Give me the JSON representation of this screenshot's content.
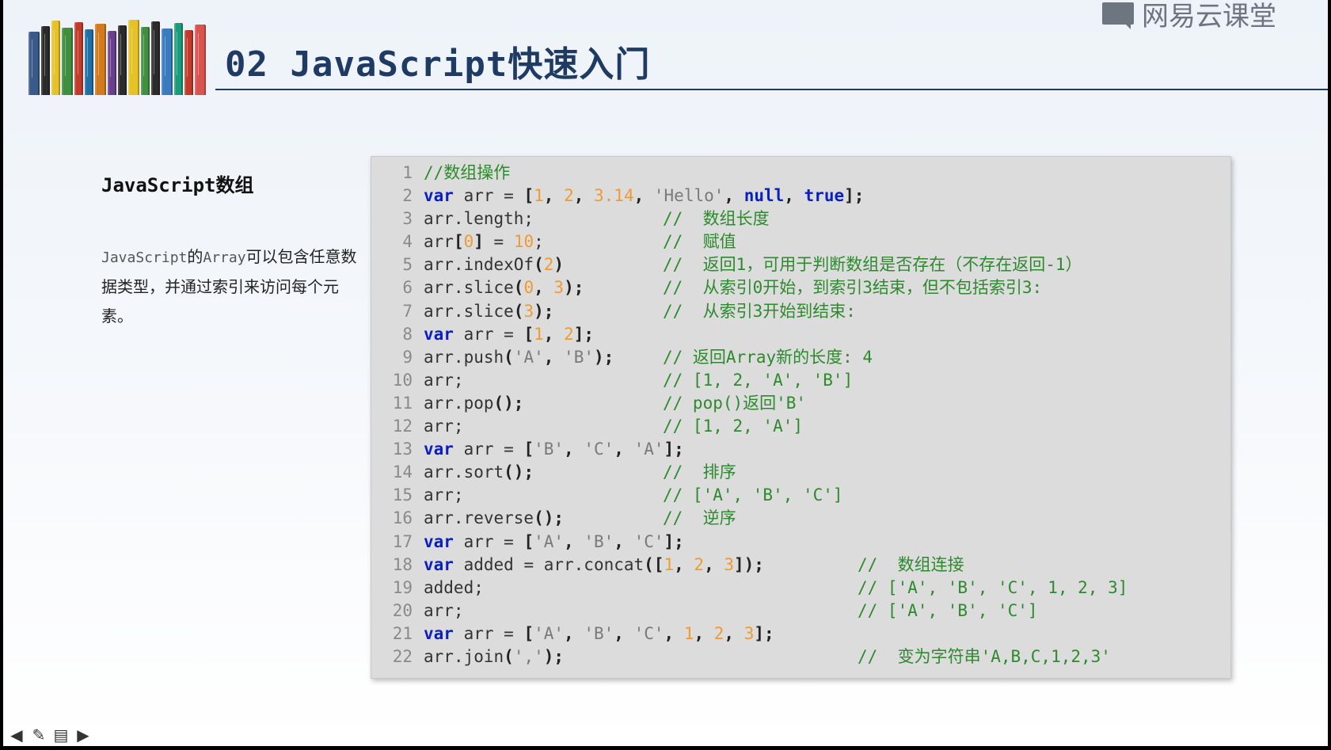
{
  "slide": {
    "title": "02 JavaScript快速入门",
    "brand_text": "网易云课堂",
    "brand_icon": "book-logo-icon",
    "section_title": "JavaScript数组",
    "description": {
      "part1": "JavaScript",
      "part2": "的",
      "part3": "Array",
      "part4": "可以包含任意数据类型，并通过索引来访问每个元素。"
    }
  },
  "books": [
    "#3a5a8a",
    "#2b2b2b",
    "#e6c229",
    "#3f8f3f",
    "#c23b2a",
    "#1f6fa8",
    "#d17a1e",
    "#6b3f8f",
    "#2b2b2b",
    "#e6c229",
    "#3f8f3f",
    "#2b2b2b",
    "#3a7bbf",
    "#1a9c7a",
    "#c23b2a",
    "#d9534f"
  ],
  "code": {
    "lines": [
      {
        "n": "1",
        "tokens": [
          {
            "t": "cm",
            "v": "//数组操作"
          }
        ]
      },
      {
        "n": "2",
        "tokens": [
          {
            "t": "kw",
            "v": "var"
          },
          {
            "t": "tx",
            "v": " arr = "
          },
          {
            "t": "pn",
            "v": "["
          },
          {
            "t": "num",
            "v": "1"
          },
          {
            "t": "pn",
            "v": ", "
          },
          {
            "t": "num",
            "v": "2"
          },
          {
            "t": "pn",
            "v": ", "
          },
          {
            "t": "num",
            "v": "3.14"
          },
          {
            "t": "pn",
            "v": ", "
          },
          {
            "t": "str",
            "v": "'Hello'"
          },
          {
            "t": "pn",
            "v": ", "
          },
          {
            "t": "kw",
            "v": "null"
          },
          {
            "t": "pn",
            "v": ", "
          },
          {
            "t": "kw",
            "v": "true"
          },
          {
            "t": "pn",
            "v": "];"
          }
        ]
      },
      {
        "n": "3",
        "tokens": [
          {
            "t": "tx",
            "v": "arr.length;"
          }
        ],
        "comment": "//  数组长度",
        "ccol": "c1"
      },
      {
        "n": "4",
        "tokens": [
          {
            "t": "tx",
            "v": "arr"
          },
          {
            "t": "pn",
            "v": "["
          },
          {
            "t": "num",
            "v": "0"
          },
          {
            "t": "pn",
            "v": "]"
          },
          {
            "t": "tx",
            "v": " = "
          },
          {
            "t": "num",
            "v": "10"
          },
          {
            "t": "tx",
            "v": ";"
          }
        ],
        "comment": "//  赋值",
        "ccol": "c1"
      },
      {
        "n": "5",
        "tokens": [
          {
            "t": "tx",
            "v": "arr.indexOf"
          },
          {
            "t": "pn",
            "v": "("
          },
          {
            "t": "num",
            "v": "2"
          },
          {
            "t": "pn",
            "v": ")"
          }
        ],
        "comment": "//  返回1，可用于判断数组是否存在（不存在返回-1）",
        "ccol": "c1"
      },
      {
        "n": "6",
        "tokens": [
          {
            "t": "tx",
            "v": "arr.slice"
          },
          {
            "t": "pn",
            "v": "("
          },
          {
            "t": "num",
            "v": "0"
          },
          {
            "t": "pn",
            "v": ", "
          },
          {
            "t": "num",
            "v": "3"
          },
          {
            "t": "pn",
            "v": ");"
          }
        ],
        "comment": "//  从索引0开始，到索引3结束，但不包括索引3:",
        "ccol": "c1"
      },
      {
        "n": "7",
        "tokens": [
          {
            "t": "tx",
            "v": "arr.slice"
          },
          {
            "t": "pn",
            "v": "("
          },
          {
            "t": "num",
            "v": "3"
          },
          {
            "t": "pn",
            "v": ");"
          }
        ],
        "comment": "//  从索引3开始到结束:",
        "ccol": "c1"
      },
      {
        "n": "8",
        "tokens": [
          {
            "t": "kw",
            "v": "var"
          },
          {
            "t": "tx",
            "v": " arr = "
          },
          {
            "t": "pn",
            "v": "["
          },
          {
            "t": "num",
            "v": "1"
          },
          {
            "t": "pn",
            "v": ", "
          },
          {
            "t": "num",
            "v": "2"
          },
          {
            "t": "pn",
            "v": "];"
          }
        ]
      },
      {
        "n": "9",
        "tokens": [
          {
            "t": "tx",
            "v": "arr.push"
          },
          {
            "t": "pn",
            "v": "("
          },
          {
            "t": "str",
            "v": "'A'"
          },
          {
            "t": "pn",
            "v": ", "
          },
          {
            "t": "str",
            "v": "'B'"
          },
          {
            "t": "pn",
            "v": ");"
          }
        ],
        "comment": "// 返回Array新的长度: 4",
        "ccol": "c1"
      },
      {
        "n": "10",
        "tokens": [
          {
            "t": "tx",
            "v": "arr;"
          }
        ],
        "comment": "// [1, 2, 'A', 'B']",
        "ccol": "c1"
      },
      {
        "n": "11",
        "tokens": [
          {
            "t": "tx",
            "v": "arr.pop"
          },
          {
            "t": "pn",
            "v": "();"
          }
        ],
        "comment": "// pop()返回'B'",
        "ccol": "c1"
      },
      {
        "n": "12",
        "tokens": [
          {
            "t": "tx",
            "v": "arr;"
          }
        ],
        "comment": "// [1, 2, 'A']",
        "ccol": "c1"
      },
      {
        "n": "13",
        "tokens": [
          {
            "t": "kw",
            "v": "var"
          },
          {
            "t": "tx",
            "v": " arr = "
          },
          {
            "t": "pn",
            "v": "["
          },
          {
            "t": "str",
            "v": "'B'"
          },
          {
            "t": "pn",
            "v": ", "
          },
          {
            "t": "str",
            "v": "'C'"
          },
          {
            "t": "pn",
            "v": ", "
          },
          {
            "t": "str",
            "v": "'A'"
          },
          {
            "t": "pn",
            "v": "];"
          }
        ]
      },
      {
        "n": "14",
        "tokens": [
          {
            "t": "tx",
            "v": "arr.sort"
          },
          {
            "t": "pn",
            "v": "();"
          }
        ],
        "comment": "//  排序",
        "ccol": "c1"
      },
      {
        "n": "15",
        "tokens": [
          {
            "t": "tx",
            "v": "arr;"
          }
        ],
        "comment": "// ['A', 'B', 'C']",
        "ccol": "c1"
      },
      {
        "n": "16",
        "tokens": [
          {
            "t": "tx",
            "v": "arr.reverse"
          },
          {
            "t": "pn",
            "v": "();"
          }
        ],
        "comment": "//  逆序",
        "ccol": "c1"
      },
      {
        "n": "17",
        "tokens": [
          {
            "t": "kw",
            "v": "var"
          },
          {
            "t": "tx",
            "v": " arr = "
          },
          {
            "t": "pn",
            "v": "["
          },
          {
            "t": "str",
            "v": "'A'"
          },
          {
            "t": "pn",
            "v": ", "
          },
          {
            "t": "str",
            "v": "'B'"
          },
          {
            "t": "pn",
            "v": ", "
          },
          {
            "t": "str",
            "v": "'C'"
          },
          {
            "t": "pn",
            "v": "];"
          }
        ]
      },
      {
        "n": "18",
        "tokens": [
          {
            "t": "kw",
            "v": "var"
          },
          {
            "t": "tx",
            "v": " added = arr.concat"
          },
          {
            "t": "pn",
            "v": "(["
          },
          {
            "t": "num",
            "v": "1"
          },
          {
            "t": "pn",
            "v": ", "
          },
          {
            "t": "num",
            "v": "2"
          },
          {
            "t": "pn",
            "v": ", "
          },
          {
            "t": "num",
            "v": "3"
          },
          {
            "t": "pn",
            "v": "]);"
          }
        ],
        "comment": "//  数组连接",
        "ccol": "c2"
      },
      {
        "n": "19",
        "tokens": [
          {
            "t": "tx",
            "v": "added;"
          }
        ],
        "comment": "// ['A', 'B', 'C', 1, 2, 3]",
        "ccol": "c2"
      },
      {
        "n": "20",
        "tokens": [
          {
            "t": "tx",
            "v": "arr;"
          }
        ],
        "comment": "// ['A', 'B', 'C']",
        "ccol": "c2"
      },
      {
        "n": "21",
        "tokens": [
          {
            "t": "kw",
            "v": "var"
          },
          {
            "t": "tx",
            "v": " arr = "
          },
          {
            "t": "pn",
            "v": "["
          },
          {
            "t": "str",
            "v": "'A'"
          },
          {
            "t": "pn",
            "v": ", "
          },
          {
            "t": "str",
            "v": "'B'"
          },
          {
            "t": "pn",
            "v": ", "
          },
          {
            "t": "str",
            "v": "'C'"
          },
          {
            "t": "pn",
            "v": ", "
          },
          {
            "t": "num",
            "v": "1"
          },
          {
            "t": "pn",
            "v": ", "
          },
          {
            "t": "num",
            "v": "2"
          },
          {
            "t": "pn",
            "v": ", "
          },
          {
            "t": "num",
            "v": "3"
          },
          {
            "t": "pn",
            "v": "];"
          }
        ]
      },
      {
        "n": "22",
        "tokens": [
          {
            "t": "tx",
            "v": "arr.join"
          },
          {
            "t": "pn",
            "v": "("
          },
          {
            "t": "str",
            "v": "','"
          },
          {
            "t": "pn",
            "v": ");"
          }
        ],
        "comment": "//  变为字符串'A,B,C,1,2,3'",
        "ccol": "c2"
      }
    ]
  },
  "nav": {
    "icons": [
      "arrow-left-icon",
      "pen-icon",
      "menu-icon",
      "arrow-right-icon"
    ],
    "glyphs": [
      "◀",
      "✎",
      "▤",
      "▶"
    ]
  },
  "colors": {
    "title": "#1f3b63",
    "keyword": "#0a1fbf",
    "number": "#f09a34",
    "string": "#7a7a7a",
    "comment": "#2d8a2d",
    "code_bg": "#dcdcdc"
  }
}
